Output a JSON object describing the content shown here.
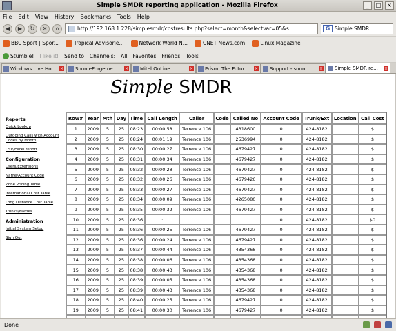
{
  "window": {
    "title": "Simple SMDR reporting application - Mozilla Firefox"
  },
  "menu": [
    "File",
    "Edit",
    "View",
    "History",
    "Bookmarks",
    "Tools",
    "Help"
  ],
  "nav": {
    "url": "http://192.168.1.228/simplesmdr/costresults.php?select=month&selectvar=05&s",
    "search_value": "Simple SMDR"
  },
  "bookmarks": [
    "BBC Sport | Spor...",
    "Tropical Advisorie...",
    "Network World N...",
    "CNET News.com",
    "Linux Magazine"
  ],
  "toolbar2": [
    "Stumble!",
    "I like it!",
    "Send to",
    "Channels:",
    "All",
    "Favorites",
    "Friends",
    "Tools"
  ],
  "tabs": [
    "Windows Live Ho...",
    "SourceForge.ne...",
    "Mitel OnLine",
    "Prism: The Futur...",
    "Support - sourc...",
    "Simple SMDR re..."
  ],
  "logo": {
    "part1": "Simple",
    "part2": "SMDR"
  },
  "sidebar": {
    "reports_heading": "Reports",
    "reports": [
      "Quick Lookup",
      "Outgoing Calls with Account Codes by Month",
      "CSV/Excel report"
    ],
    "config_heading": "Configuration",
    "config": [
      "Users/Extensions",
      "Name/Account Code",
      "Zone Pricing Table",
      "International Cost Table",
      "Long Distance Cost Table",
      "Trunks/Names"
    ],
    "admin_heading": "Administration",
    "admin": [
      "Initial System Setup",
      "Sign Out"
    ]
  },
  "table": {
    "headers": [
      "Row#",
      "Year",
      "Mth",
      "Day",
      "Time",
      "Call Length",
      "Caller",
      "Code",
      "Called No",
      "Account Code",
      "Trunk/Ext",
      "Location",
      "Call Cost"
    ],
    "rows": [
      [
        "1",
        "2009",
        "5",
        "25",
        "08:23",
        "00:00:58",
        "Terrence 106",
        "",
        "4318600",
        "0",
        "424-8182",
        "",
        "$"
      ],
      [
        "2",
        "2009",
        "5",
        "25",
        "08:24",
        "00:01:19",
        "Terrence 106",
        "",
        "2536994",
        "0",
        "424-8182",
        "",
        "$"
      ],
      [
        "3",
        "2009",
        "5",
        "25",
        "08:30",
        "00:00:27",
        "Terrence 106",
        "",
        "4679427",
        "0",
        "424-8182",
        "",
        "$"
      ],
      [
        "4",
        "2009",
        "5",
        "25",
        "08:31",
        "00:00:34",
        "Terrence 106",
        "",
        "4679427",
        "0",
        "424-8182",
        "",
        "$"
      ],
      [
        "5",
        "2009",
        "5",
        "25",
        "08:32",
        "00:00:28",
        "Terrence 106",
        "",
        "4679427",
        "0",
        "424-8182",
        "",
        "$"
      ],
      [
        "6",
        "2009",
        "5",
        "25",
        "08:32",
        "00:00:26",
        "Terrence 106",
        "",
        "4679426",
        "0",
        "424-8182",
        "",
        "$"
      ],
      [
        "7",
        "2009",
        "5",
        "25",
        "08:33",
        "00:00:27",
        "Terrence 106",
        "",
        "4679427",
        "0",
        "424-8182",
        "",
        "$"
      ],
      [
        "8",
        "2009",
        "5",
        "25",
        "08:34",
        "00:00:09",
        "Terrence 106",
        "",
        "4265080",
        "0",
        "424-8182",
        "",
        "$"
      ],
      [
        "9",
        "2009",
        "5",
        "25",
        "08:35",
        "00:00:32",
        "Terrence 106",
        "",
        "4679427",
        "0",
        "424-8182",
        "",
        "$"
      ],
      [
        "10",
        "2009",
        "5",
        "25",
        "08:36",
        ":",
        "",
        "",
        "",
        "0",
        "424-8182",
        "",
        "$0"
      ],
      [
        "11",
        "2009",
        "5",
        "25",
        "08:36",
        "00:00:25",
        "Terrence 106",
        "",
        "4679427",
        "0",
        "424-8182",
        "",
        "$"
      ],
      [
        "12",
        "2009",
        "5",
        "25",
        "08:36",
        "00:00:24",
        "Terrence 106",
        "",
        "4679427",
        "0",
        "424-8182",
        "",
        "$"
      ],
      [
        "13",
        "2009",
        "5",
        "25",
        "08:37",
        "00:00:44",
        "Terrence 106",
        "",
        "4354368",
        "0",
        "424-8182",
        "",
        "$"
      ],
      [
        "14",
        "2009",
        "5",
        "25",
        "08:38",
        "00:00:06",
        "Terrence 106",
        "",
        "4354368",
        "0",
        "424-8182",
        "",
        "$"
      ],
      [
        "15",
        "2009",
        "5",
        "25",
        "08:38",
        "00:00:43",
        "Terrence 106",
        "",
        "4354368",
        "0",
        "424-8182",
        "",
        "$"
      ],
      [
        "16",
        "2009",
        "5",
        "25",
        "08:39",
        "00:00:05",
        "Terrence 106",
        "",
        "4354368",
        "0",
        "424-8182",
        "",
        "$"
      ],
      [
        "17",
        "2009",
        "5",
        "25",
        "08:39",
        "00:00:43",
        "Terrence 106",
        "",
        "4354368",
        "0",
        "424-8182",
        "",
        "$"
      ],
      [
        "18",
        "2009",
        "5",
        "25",
        "08:40",
        "00:00:25",
        "Terrence 106",
        "",
        "4679427",
        "0",
        "424-8182",
        "",
        "$"
      ],
      [
        "19",
        "2009",
        "5",
        "25",
        "08:41",
        "00:00:30",
        "Terrence 106",
        "",
        "4679427",
        "0",
        "424-8182",
        "",
        "$"
      ],
      [
        "20",
        "2009",
        "5",
        "25",
        "08:41",
        "00:00:27",
        "Terrence 106",
        "",
        "4679427",
        "0",
        "424-6865",
        "",
        "$"
      ]
    ]
  },
  "status": {
    "text": "Done"
  }
}
